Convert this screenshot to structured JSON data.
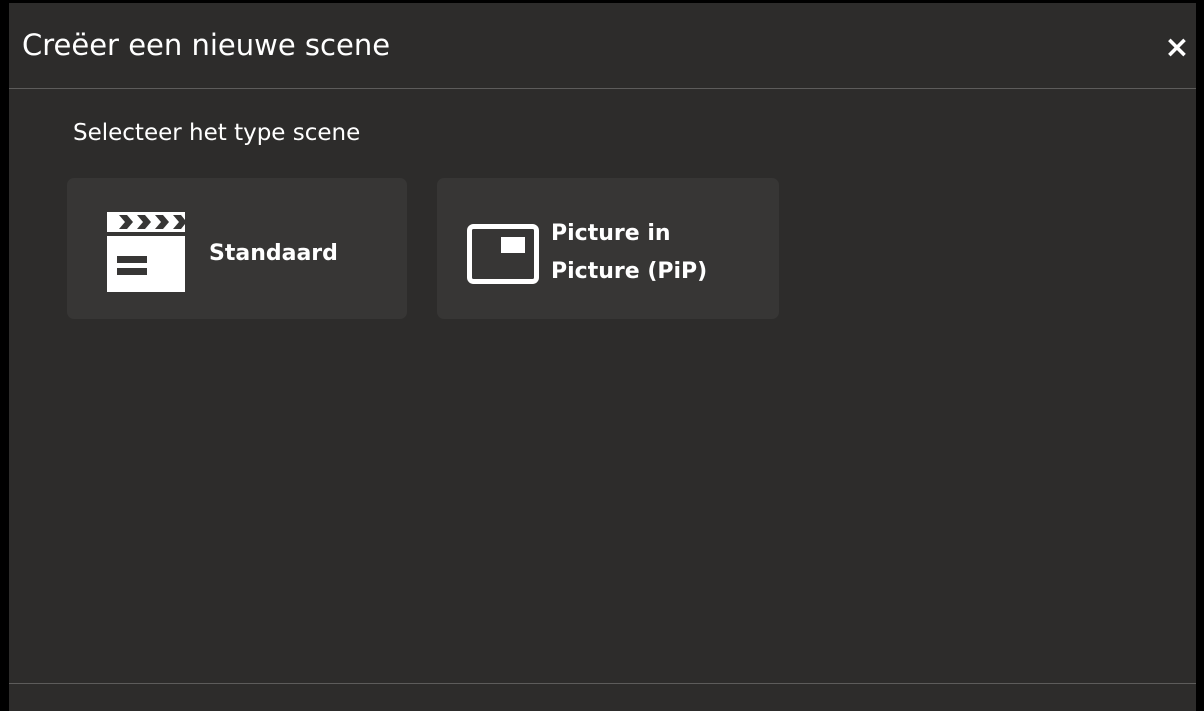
{
  "dialog": {
    "title": "Creëer een nieuwe scene",
    "close_label": "×",
    "subtitle": "Selecteer het type scene"
  },
  "scene_types": [
    {
      "label": "Standaard",
      "icon": "clapperboard-icon"
    },
    {
      "label": "Picture in Picture (PiP)",
      "icon": "picture-in-picture-icon"
    }
  ],
  "colors": {
    "background": "#000000",
    "dialog_background": "#2d2c2b",
    "card_background": "#373635",
    "divider": "#5d5c5b",
    "text": "#ffffff"
  }
}
